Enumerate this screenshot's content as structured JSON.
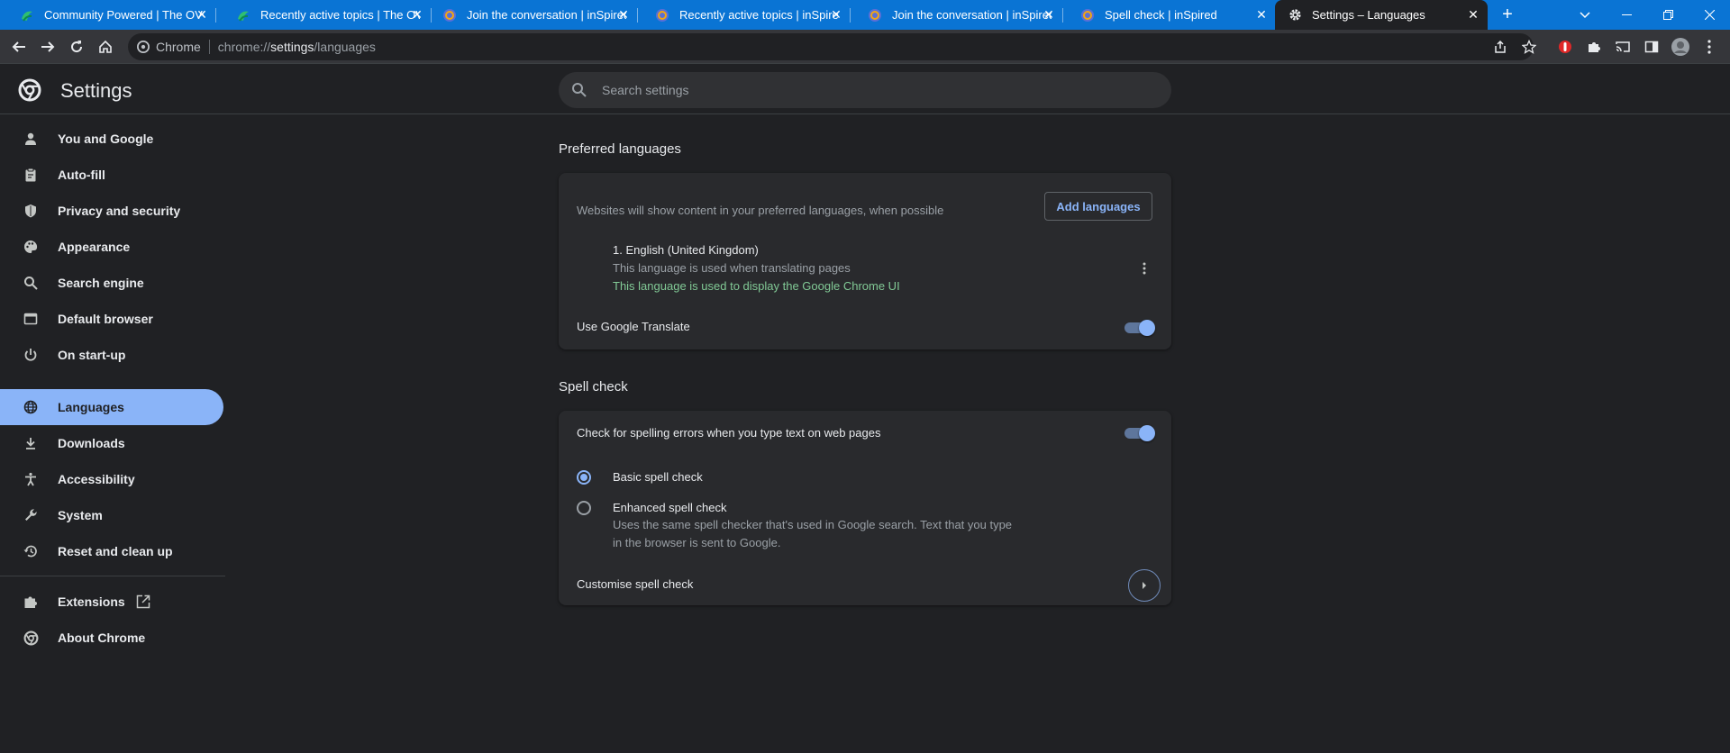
{
  "tabs": [
    {
      "title": "Community Powered | The OVO",
      "icon": "ovo-favicon"
    },
    {
      "title": "Recently active topics | The OVO",
      "icon": "ovo-favicon"
    },
    {
      "title": "Join the conversation | inSpired",
      "icon": "inspired-favicon"
    },
    {
      "title": "Recently active topics | inSpired",
      "icon": "inspired-favicon"
    },
    {
      "title": "Join the conversation | inSpired",
      "icon": "inspired-favicon"
    },
    {
      "title": "Spell check | inSpired",
      "icon": "inspired-favicon"
    },
    {
      "title": "Settings – Languages",
      "icon": "gear-icon"
    }
  ],
  "omnibox": {
    "chip": "Chrome",
    "url_prefix": "chrome://",
    "url_host": "settings",
    "url_path": "/languages"
  },
  "header": {
    "title": "Settings",
    "search_placeholder": "Search settings"
  },
  "nav": {
    "items": [
      {
        "label": "You and Google",
        "icon": "person-icon"
      },
      {
        "label": "Auto-fill",
        "icon": "clipboard-icon"
      },
      {
        "label": "Privacy and security",
        "icon": "shield-icon"
      },
      {
        "label": "Appearance",
        "icon": "palette-icon"
      },
      {
        "label": "Search engine",
        "icon": "search-icon"
      },
      {
        "label": "Default browser",
        "icon": "browser-icon"
      },
      {
        "label": "On start-up",
        "icon": "power-icon"
      },
      {
        "label": "Languages",
        "icon": "globe-icon"
      },
      {
        "label": "Downloads",
        "icon": "download-icon"
      },
      {
        "label": "Accessibility",
        "icon": "accessibility-icon"
      },
      {
        "label": "System",
        "icon": "wrench-icon"
      },
      {
        "label": "Reset and clean up",
        "icon": "history-icon"
      }
    ],
    "extensions": "Extensions",
    "about": "About Chrome",
    "active": "Languages"
  },
  "preferred": {
    "title": "Preferred languages",
    "description": "Websites will show content in your preferred languages, when possible",
    "add_button": "Add languages",
    "language": {
      "name": "1. English (United Kingdom)",
      "note_translate": "This language is used when translating pages",
      "note_ui": "This language is used to display the Google Chrome UI"
    },
    "translate_label": "Use Google Translate",
    "translate_enabled": true
  },
  "spell": {
    "title": "Spell check",
    "check_label": "Check for spelling errors when you type text on web pages",
    "check_enabled": true,
    "basic_label": "Basic spell check",
    "enhanced_label": "Enhanced spell check",
    "enhanced_desc_1": "Uses the same spell checker that's used in Google search. Text that you type",
    "enhanced_desc_2": "in the browser is sent to Google.",
    "selected": "basic",
    "customise_label": "Customise spell check"
  },
  "colors": {
    "tabbar": "#0a74d4",
    "accent": "#8ab4f8",
    "green_note": "#81c995",
    "background": "#202124",
    "card": "#292a2d"
  }
}
